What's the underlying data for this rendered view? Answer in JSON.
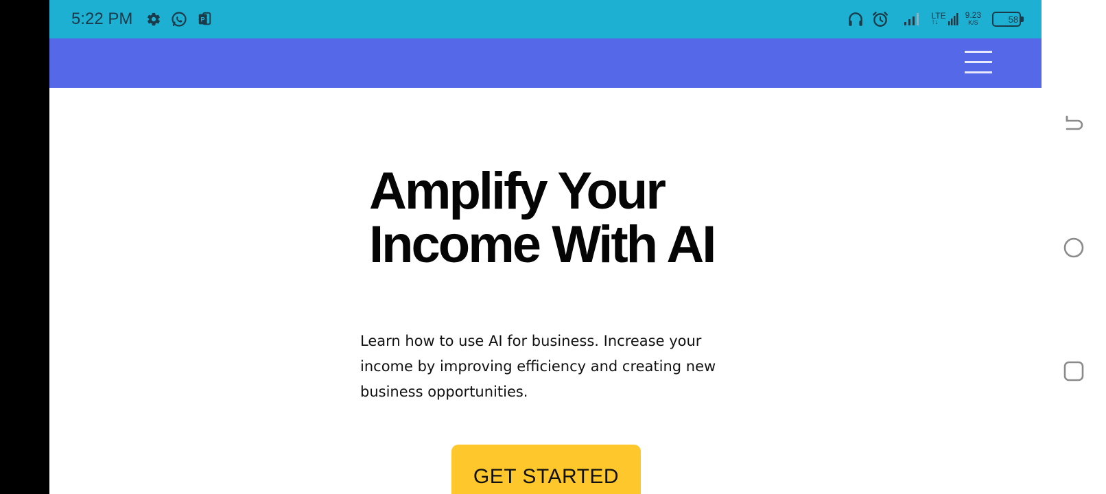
{
  "status_bar": {
    "time": "5:22 PM",
    "net_speed_value": "9.23",
    "net_speed_unit": "K/S",
    "lte_label": "LTE",
    "lte_arrows": "↑↓",
    "battery": "58",
    "battery_level_percent": 58,
    "bg_color": "#1eb0d2",
    "left_icons": [
      "gear-icon",
      "whatsapp-icon",
      "app-icon"
    ],
    "right_icons": [
      "headphones-icon",
      "alarm-icon",
      "signal-icon",
      "lte-signal-icon",
      "battery-icon"
    ]
  },
  "navbar": {
    "bg_color": "#5569e8",
    "menu_icon": "hamburger-icon"
  },
  "hero": {
    "title_line1": "Amplify Your",
    "title_line2": "Income With AI",
    "subtitle": "Learn how to use AI for business. Increase your income by improving efficiency and creating new business opportunities.",
    "cta_label": "GET STARTED",
    "cta_color": "#fec82c"
  },
  "system_nav": {
    "buttons": [
      "back-icon",
      "home-icon",
      "recents-icon"
    ]
  }
}
